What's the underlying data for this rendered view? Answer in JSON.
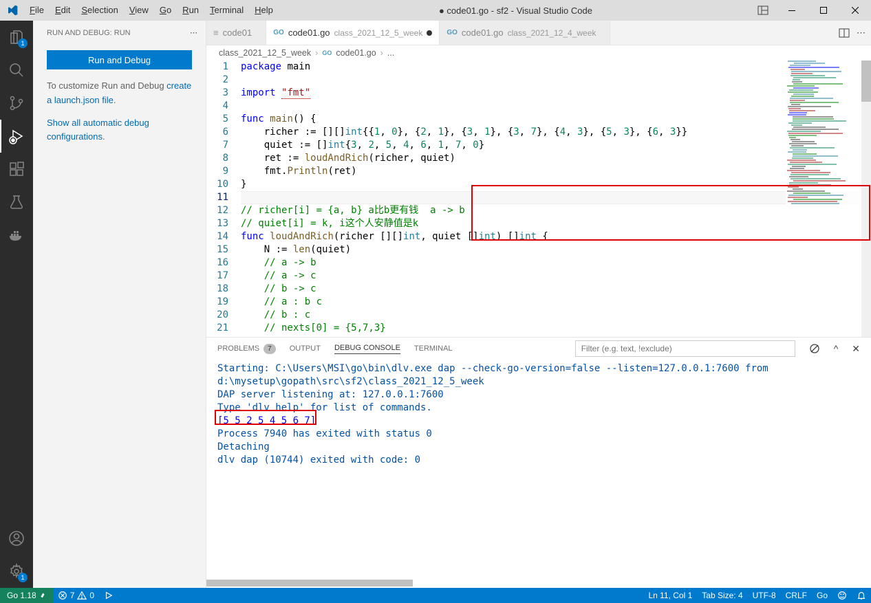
{
  "title": "● code01.go - sf2 - Visual Studio Code",
  "menubar": [
    "File",
    "Edit",
    "Selection",
    "View",
    "Go",
    "Run",
    "Terminal",
    "Help"
  ],
  "sidebar": {
    "header": "RUN AND DEBUG: RUN",
    "button": "Run and Debug",
    "text1_a": "To customize Run and Debug ",
    "text1_link": "create a launch.json file",
    "text1_b": ".",
    "text2_link": "Show all automatic debug configurations",
    "text2_b": "."
  },
  "activitybar": {
    "explorer_badge": "1",
    "settings_badge": "1"
  },
  "tabs": [
    {
      "name": "code01",
      "desc": "",
      "go": false,
      "active": false,
      "modified": false
    },
    {
      "name": "code01.go",
      "desc": "class_2021_12_5_week",
      "go": true,
      "active": true,
      "modified": true
    },
    {
      "name": "code01.go",
      "desc": "class_2021_12_4_week",
      "go": true,
      "active": false,
      "modified": false
    }
  ],
  "breadcrumb": {
    "a": "class_2021_12_5_week",
    "b": "code01.go",
    "c": "..."
  },
  "code_lines": [
    {
      "n": 1,
      "h": "<span class='kw'>package</span> main"
    },
    {
      "n": 2,
      "h": ""
    },
    {
      "n": 3,
      "h": "<span class='kw'>import</span> <span class='str err-underline'>\"fmt\"</span>"
    },
    {
      "n": 4,
      "h": ""
    },
    {
      "n": 5,
      "h": "<span class='kw'>func</span> <span class='fn'>main</span>() {"
    },
    {
      "n": 6,
      "h": "    richer := [][]<span class='typ'>int</span>{{<span class='num'>1</span>, <span class='num'>0</span>}, {<span class='num'>2</span>, <span class='num'>1</span>}, {<span class='num'>3</span>, <span class='num'>1</span>}, {<span class='num'>3</span>, <span class='num'>7</span>}, {<span class='num'>4</span>, <span class='num'>3</span>}, {<span class='num'>5</span>, <span class='num'>3</span>}, {<span class='num'>6</span>, <span class='num'>3</span>}}"
    },
    {
      "n": 7,
      "h": "    quiet := []<span class='typ'>int</span>{<span class='num'>3</span>, <span class='num'>2</span>, <span class='num'>5</span>, <span class='num'>4</span>, <span class='num'>6</span>, <span class='num'>1</span>, <span class='num'>7</span>, <span class='num'>0</span>}"
    },
    {
      "n": 8,
      "h": "    ret := <span class='fn'>loudAndRich</span>(richer, quiet)"
    },
    {
      "n": 9,
      "h": "    fmt.<span class='fn'>Println</span>(ret)"
    },
    {
      "n": 10,
      "h": "}"
    },
    {
      "n": 11,
      "h": "",
      "cur": true
    },
    {
      "n": 12,
      "h": "<span class='cmt'>// richer[i] = {a, b} a比b更有钱  a -&gt; b</span>"
    },
    {
      "n": 13,
      "h": "<span class='cmt'>// quiet[i] = k, i这个人安静值是k</span>"
    },
    {
      "n": 14,
      "h": "<span class='kw'>func</span> <span class='fn'>loudAndRich</span>(richer [][]<span class='typ'>int</span>, quiet []<span class='typ'>int</span>) []<span class='typ'>int</span> {"
    },
    {
      "n": 15,
      "h": "    N := <span class='fn'>len</span>(quiet)"
    },
    {
      "n": 16,
      "h": "    <span class='cmt'>// a -&gt; b</span>"
    },
    {
      "n": 17,
      "h": "    <span class='cmt'>// a -&gt; c</span>"
    },
    {
      "n": 18,
      "h": "    <span class='cmt'>// b -&gt; c</span>"
    },
    {
      "n": 19,
      "h": "    <span class='cmt'>// a : b c</span>"
    },
    {
      "n": 20,
      "h": "    <span class='cmt'>// b : c</span>"
    },
    {
      "n": 21,
      "h": "    <span class='cmt'>// nexts[0] = {5,7,3}</span>"
    }
  ],
  "panel": {
    "tabs": {
      "problems": "PROBLEMS",
      "problems_count": "7",
      "output": "OUTPUT",
      "debug": "DEBUG CONSOLE",
      "terminal": "TERMINAL"
    },
    "filter_placeholder": "Filter (e.g. text, !exclude)",
    "lines": [
      {
        "cls": "pc-blue",
        "t": "Starting: C:\\Users\\MSI\\go\\bin\\dlv.exe dap --check-go-version=false --listen=127.0.0.1:7600 from d:\\mysetup\\gopath\\src\\sf2\\class_2021_12_5_week"
      },
      {
        "cls": "pc-blue",
        "t": "DAP server listening at: 127.0.0.1:7600"
      },
      {
        "cls": "pc-blue",
        "t": "Type 'dlv help' for list of commands."
      },
      {
        "cls": "pc-link",
        "t": "[5 5 2 5 4 5 6 7]"
      },
      {
        "cls": "pc-blue",
        "t": "Process 7940 has exited with status 0"
      },
      {
        "cls": "pc-blue",
        "t": "Detaching"
      },
      {
        "cls": "pc-blue",
        "t": "dlv dap (10744) exited with code: 0"
      }
    ]
  },
  "statusbar": {
    "go": "Go 1.18",
    "err": "7",
    "warn": "0",
    "pos": "Ln 11, Col 1",
    "tab": "Tab Size: 4",
    "enc": "UTF-8",
    "eol": "CRLF",
    "lang": "Go"
  }
}
